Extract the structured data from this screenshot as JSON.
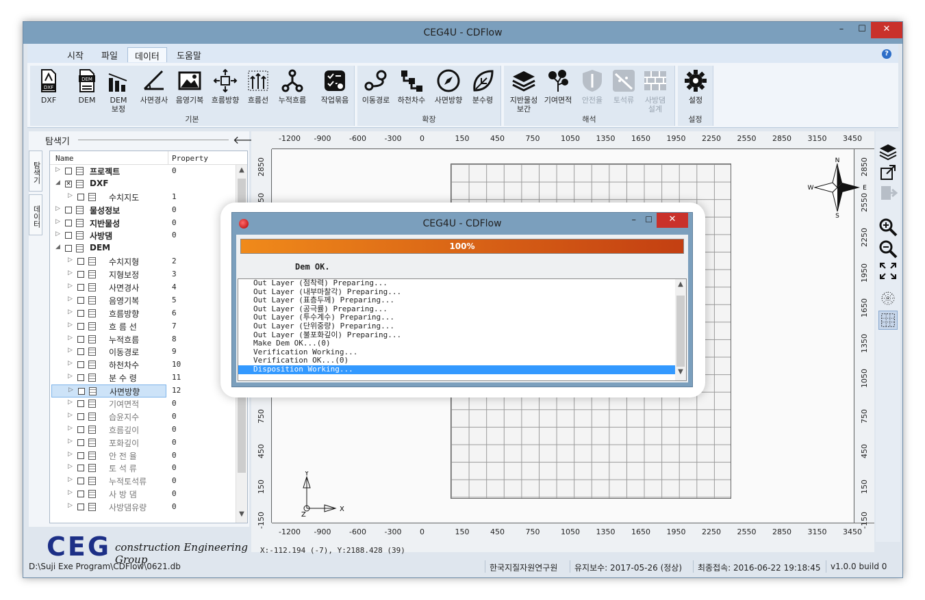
{
  "window": {
    "title": "CEG4U - CDFlow",
    "minimize": "–",
    "maximize": "☐",
    "close": "✕"
  },
  "menu": {
    "items": [
      "시작",
      "파일",
      "데이터",
      "도움말"
    ],
    "active": "데이터",
    "help": "?"
  },
  "ribbon": {
    "groups": [
      {
        "label": "기본",
        "tools": [
          "DXF",
          "DEM",
          "DEM\n보정",
          "사면경사",
          "음영기복",
          "흐름방향",
          "흐름선",
          "누적흐름",
          "작업묶음"
        ]
      },
      {
        "label": "확장",
        "tools": [
          "이동경로",
          "하천차수",
          "사면방향",
          "분수령"
        ]
      },
      {
        "label": "해석",
        "tools": [
          "지반물성\n보간",
          "기여면적",
          "안전율",
          "토석류",
          "사방댐\n설계"
        ]
      },
      {
        "label": "설정",
        "tools": [
          "설정"
        ]
      }
    ]
  },
  "explorer": {
    "title": "탐색기",
    "back_arrow": "🡐",
    "vtabs": [
      "탐색기",
      "데이터"
    ],
    "columns": {
      "name": "Name",
      "property": "Property"
    },
    "rows": [
      {
        "label": "프로젝트",
        "value": "0",
        "level": 0,
        "bold": true,
        "expand": "▷"
      },
      {
        "label": "DXF",
        "value": "",
        "level": 0,
        "bold": true,
        "expand": "◢",
        "checked": "x"
      },
      {
        "label": "수치지도",
        "value": "1",
        "level": 1,
        "bold": false,
        "expand": "▷"
      },
      {
        "label": "물성정보",
        "value": "0",
        "level": 0,
        "bold": true,
        "expand": "▷"
      },
      {
        "label": "지반물성",
        "value": "0",
        "level": 0,
        "bold": true,
        "expand": "▷"
      },
      {
        "label": "사방댐",
        "value": "0",
        "level": 0,
        "bold": true,
        "expand": "▷"
      },
      {
        "label": "DEM",
        "value": "",
        "level": 0,
        "bold": true,
        "expand": "◢"
      },
      {
        "label": "수치지형",
        "value": "2",
        "level": 1,
        "bold": false,
        "expand": "▷"
      },
      {
        "label": "지형보정",
        "value": "3",
        "level": 1,
        "bold": false,
        "expand": "▷"
      },
      {
        "label": "사면경사",
        "value": "4",
        "level": 1,
        "bold": false,
        "expand": "▷"
      },
      {
        "label": "음영기복",
        "value": "5",
        "level": 1,
        "bold": false,
        "expand": "▷"
      },
      {
        "label": "흐름방향",
        "value": "6",
        "level": 1,
        "bold": false,
        "expand": "▷"
      },
      {
        "label": "흐 름 선",
        "value": "7",
        "level": 1,
        "bold": false,
        "expand": "▷"
      },
      {
        "label": "누적흐름",
        "value": "8",
        "level": 1,
        "bold": false,
        "expand": "▷"
      },
      {
        "label": "이동경로",
        "value": "9",
        "level": 1,
        "bold": false,
        "expand": "▷"
      },
      {
        "label": "하천차수",
        "value": "10",
        "level": 1,
        "bold": false,
        "expand": "▷"
      },
      {
        "label": "분 수 령",
        "value": "11",
        "level": 1,
        "bold": false,
        "expand": "▷"
      },
      {
        "label": "사면방향",
        "value": "12",
        "level": 1,
        "bold": false,
        "expand": "▷",
        "selected": true
      },
      {
        "label": "기여면적",
        "value": "0",
        "level": 1,
        "bold": false,
        "expand": "▷",
        "gray": true
      },
      {
        "label": "습윤지수",
        "value": "0",
        "level": 1,
        "bold": false,
        "expand": "▷",
        "gray": true
      },
      {
        "label": "흐름깊이",
        "value": "0",
        "level": 1,
        "bold": false,
        "expand": "▷",
        "gray": true
      },
      {
        "label": "포화깊이",
        "value": "0",
        "level": 1,
        "bold": false,
        "expand": "▷",
        "gray": true
      },
      {
        "label": "안 전 율",
        "value": "0",
        "level": 1,
        "bold": false,
        "expand": "▷",
        "gray": true
      },
      {
        "label": "토 석 류",
        "value": "0",
        "level": 1,
        "bold": false,
        "expand": "▷",
        "gray": true
      },
      {
        "label": "누적토석류",
        "value": "0",
        "level": 1,
        "bold": false,
        "expand": "▷",
        "gray": true
      },
      {
        "label": "사 방 댐",
        "value": "0",
        "level": 1,
        "bold": false,
        "expand": "▷",
        "gray": true
      },
      {
        "label": "사방댐유량",
        "value": "0",
        "level": 1,
        "bold": false,
        "expand": "▷",
        "gray": true
      }
    ]
  },
  "logo": {
    "big": "CEG",
    "small": "construction Engineering Group"
  },
  "rulers": {
    "x_ticks": [
      "-1200",
      "-900",
      "-600",
      "-300",
      "0",
      "150",
      "450",
      "750",
      "1050",
      "1350",
      "1650",
      "1950",
      "2250",
      "2550",
      "2850",
      "3150",
      "3450"
    ],
    "y_ticks": [
      "2850",
      "2550",
      "2250",
      "1950",
      "1650",
      "1350",
      "1050",
      "750",
      "450",
      "150",
      "-150"
    ]
  },
  "compass": {
    "n": "N",
    "s": "S",
    "e": "E",
    "w": "W"
  },
  "axes": {
    "x": "X",
    "y": "Y",
    "z": "Z"
  },
  "coord_readout": "X:-112.194 (-7), Y:2188.428 (39)",
  "status": {
    "path": "D:\\Suji Exe Program\\CDFlow\\0621.db",
    "org": "한국지질자원연구원",
    "maintenance": "유지보수: 2017-05-26 (정상)",
    "last_login": "최종접속: 2016-06-22 19:18:45",
    "version": "v1.0.0 build 0"
  },
  "dialog": {
    "title": "CEG4U - CDFlow",
    "progress_text": "100%",
    "progress_value": 1.0,
    "status": "Dem OK.",
    "log": [
      "Out Layer (점착력) Preparing...",
      "Out Layer (내부마찰각) Preparing...",
      "Out Layer (표층두께) Preparing...",
      "Out Layer (공극률) Preparing...",
      "Out Layer (투수계수) Preparing...",
      "Out Layer (단위중량) Preparing...",
      "Out Layer (불포화깊이) Preparing...",
      "Make Dem OK...(0)",
      "Verification Working...",
      "Verification OK...(0)",
      "Disposition Working..."
    ]
  }
}
